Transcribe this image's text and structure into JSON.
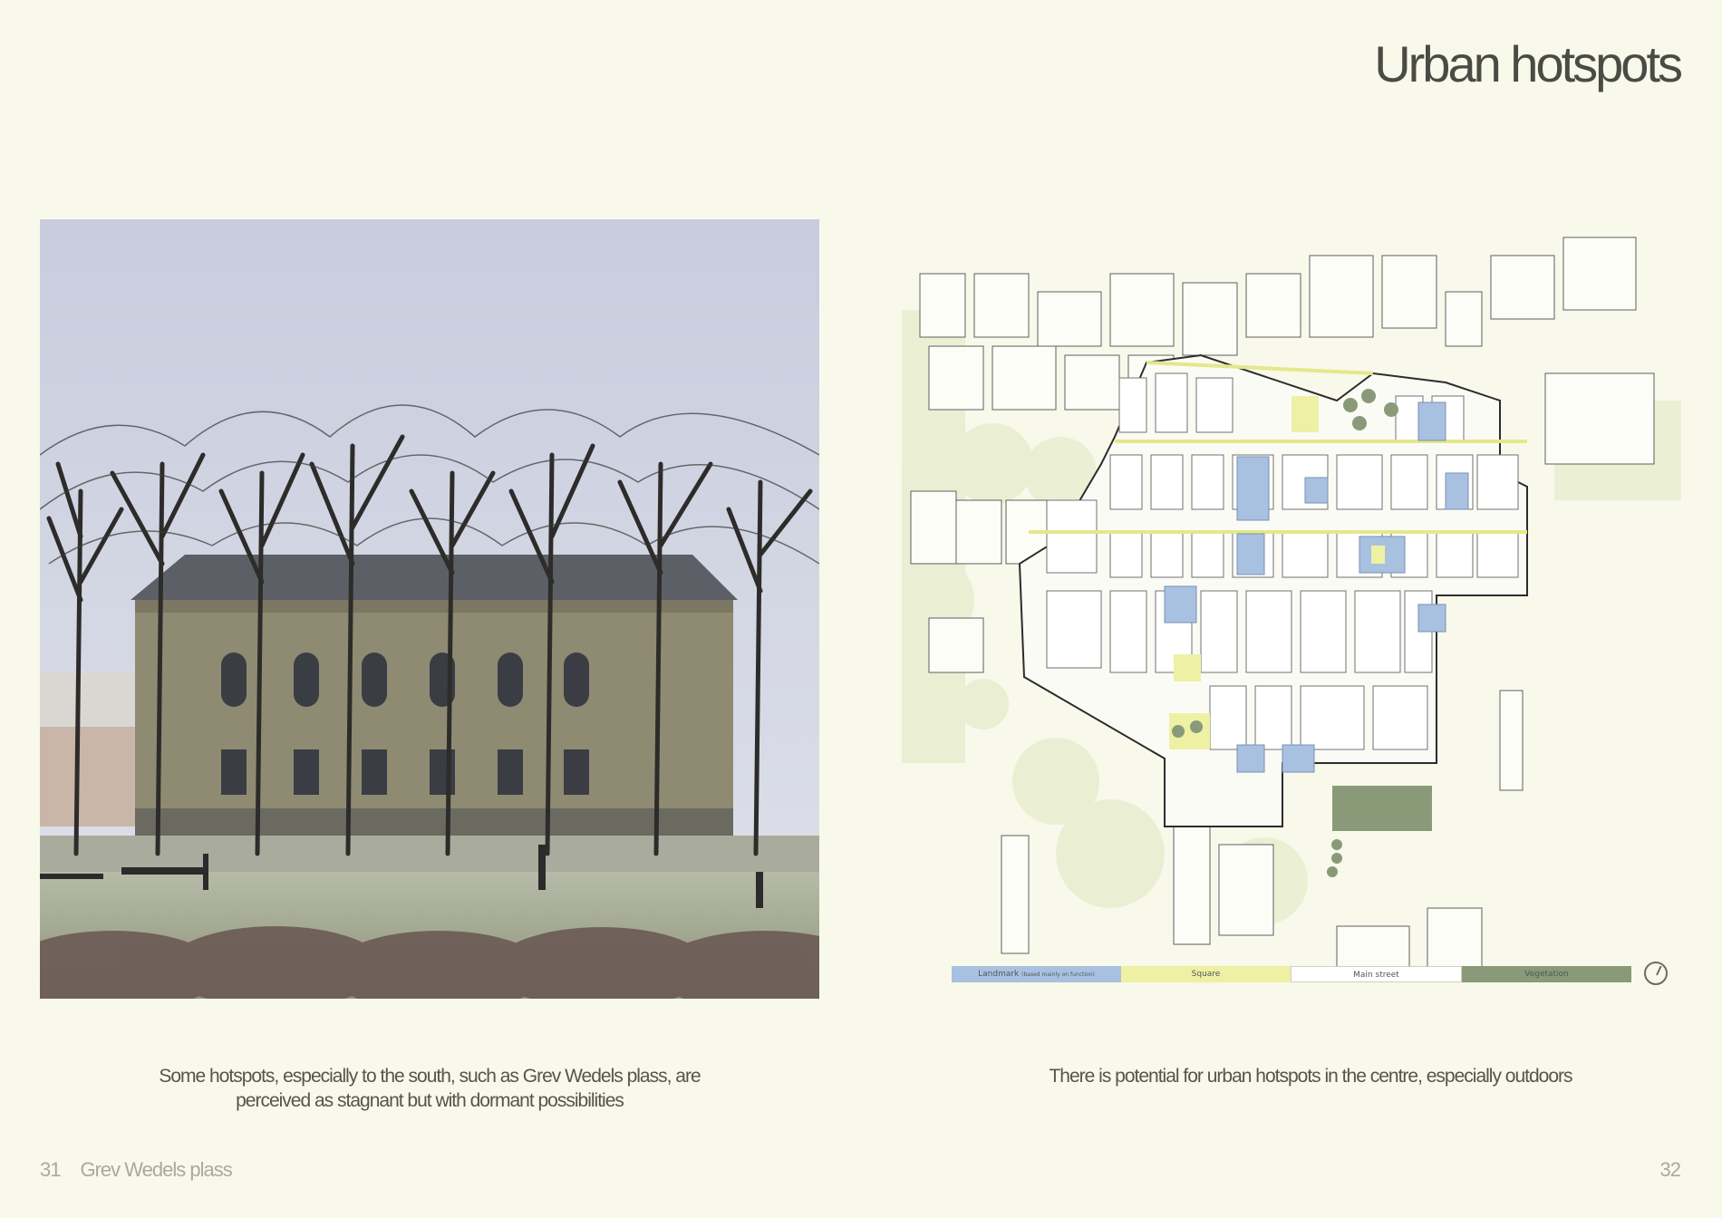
{
  "page": {
    "title": "Urban hotspots",
    "left_caption": "Some hotspots, especially to the south, such as Grev Wedels plass, are perceived as stagnant but with dormant possibilities",
    "right_caption": "There is potential for urban hotspots in the centre, especially outdoors",
    "left_page_number": "31",
    "left_section": "Grev Wedels plass",
    "right_page_number": "32"
  },
  "photo": {
    "icon": "park-building-photo"
  },
  "map": {
    "legend": [
      {
        "label": "Landmark",
        "note": "(based mainly on function)",
        "color": "#a9c1e0"
      },
      {
        "label": "Square",
        "note": "",
        "color": "#eef0a4"
      },
      {
        "label": "Main street",
        "note": "",
        "color": "#ffffff"
      },
      {
        "label": "Vegetation",
        "note": "",
        "color": "#8a9a78"
      }
    ],
    "icon": "north-arrow-icon"
  }
}
